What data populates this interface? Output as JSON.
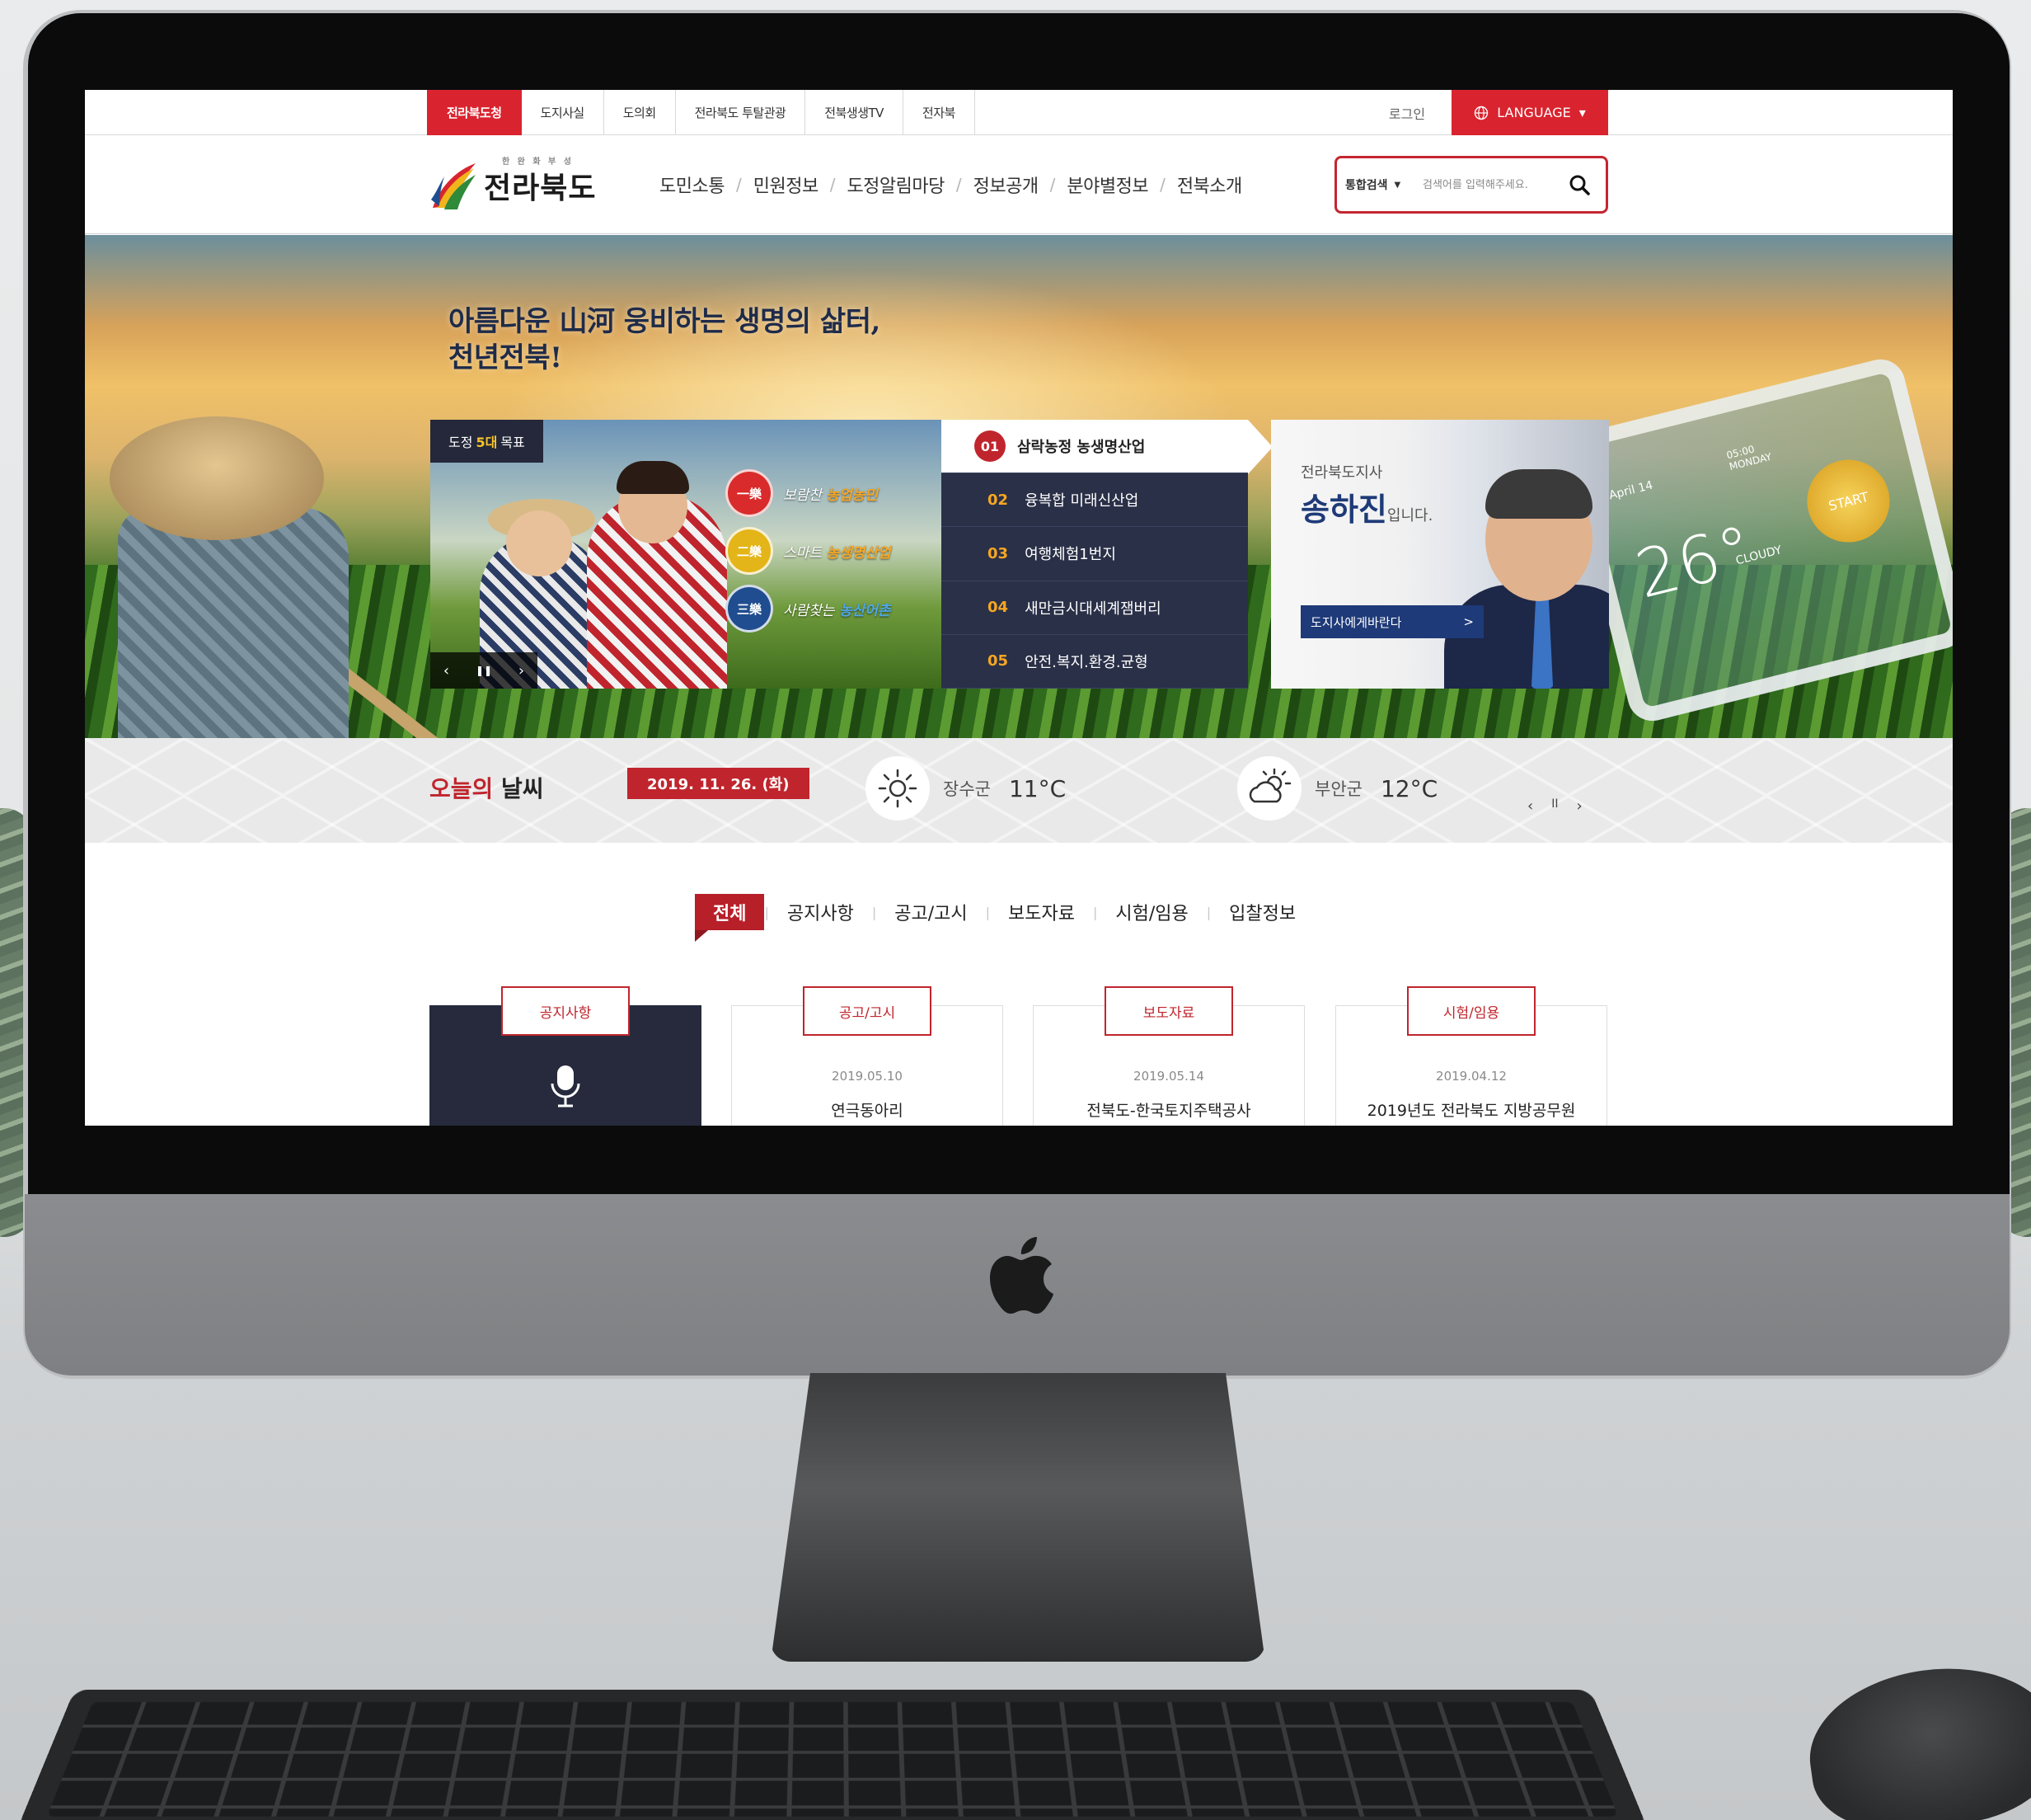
{
  "topbar": {
    "sites": [
      "전라북도청",
      "도지사실",
      "도의회",
      "전라북도 투탈관광",
      "전북생생TV",
      "전자북"
    ],
    "login": "로그인",
    "language": "LANGUAGE"
  },
  "header": {
    "logo_text": "전라북도",
    "logo_sub": "한 완 화 부 성",
    "gnb": [
      "도민소통",
      "민원정보",
      "도정알림마당",
      "정보공개",
      "분야별정보",
      "전북소개"
    ],
    "search_scope": "통합검색",
    "search_placeholder": "검색어를 입력해주세요."
  },
  "hero": {
    "slogan_line1": "아름다운 山河 웅비하는 생명의 삶터,",
    "slogan_line2": "천년전북!",
    "goals_label_prefix": "도정",
    "goals_label_highlight": "5대",
    "goals_label_suffix": "목표",
    "chips": [
      {
        "badge": "一樂",
        "text": "보람찬",
        "highlight": "농업농민",
        "color": "#d92b2b"
      },
      {
        "badge": "二樂",
        "text": "스마트",
        "highlight": "농생명산업",
        "color": "#e4b518"
      },
      {
        "badge": "三樂",
        "text": "사람찾는",
        "highlight": "농산어촌",
        "color": "#1f4d8f"
      }
    ],
    "slide_controls": [
      "‹",
      "❚❚",
      "›"
    ],
    "goals": [
      {
        "num": "01",
        "label": "삼락농정 농생명산업"
      },
      {
        "num": "02",
        "label": "융복합 미래신산업"
      },
      {
        "num": "03",
        "label": "여행체험1번지"
      },
      {
        "num": "04",
        "label": "새만금시대세계잼버리"
      },
      {
        "num": "05",
        "label": "안전.복지.환경.균형"
      }
    ],
    "governor": {
      "title": "전라북도지사",
      "name": "송하진",
      "suffix": "입니다.",
      "button": "도지사에게바란다",
      "button_arrow": ">"
    },
    "tablet": {
      "date": "April 14",
      "time": "05:00",
      "day": "MONDAY",
      "temp": "26°",
      "condition": "CLOUDY",
      "start": "START"
    }
  },
  "weather": {
    "title_red": "오늘의",
    "title_rest": "날씨",
    "date": "2019. 11. 26. (화)",
    "items": [
      {
        "region": "장수군",
        "temp": "11°C",
        "icon": "sun-icon"
      },
      {
        "region": "부안군",
        "temp": "12°C",
        "icon": "cloud-sun-icon"
      }
    ],
    "controls": [
      "‹",
      "II",
      "›"
    ]
  },
  "board": {
    "tabs": [
      "전체",
      "공지사항",
      "공고/고시",
      "보도자료",
      "시험/임용",
      "입찰정보"
    ],
    "cards": [
      {
        "badge": "공지사항",
        "date": "",
        "title": ""
      },
      {
        "badge": "공고/고시",
        "date": "2019.05.10",
        "title": "연극동아리"
      },
      {
        "badge": "보도자료",
        "date": "2019.05.14",
        "title": "전북도-한국토지주택공사"
      },
      {
        "badge": "시험/임용",
        "date": "2019.04.12",
        "title": "2019년도 전라북도 지방공무원"
      }
    ]
  },
  "colors": {
    "brand_red": "#d9242f",
    "navy": "#2a3047",
    "governor_blue": "#1e3a78"
  }
}
